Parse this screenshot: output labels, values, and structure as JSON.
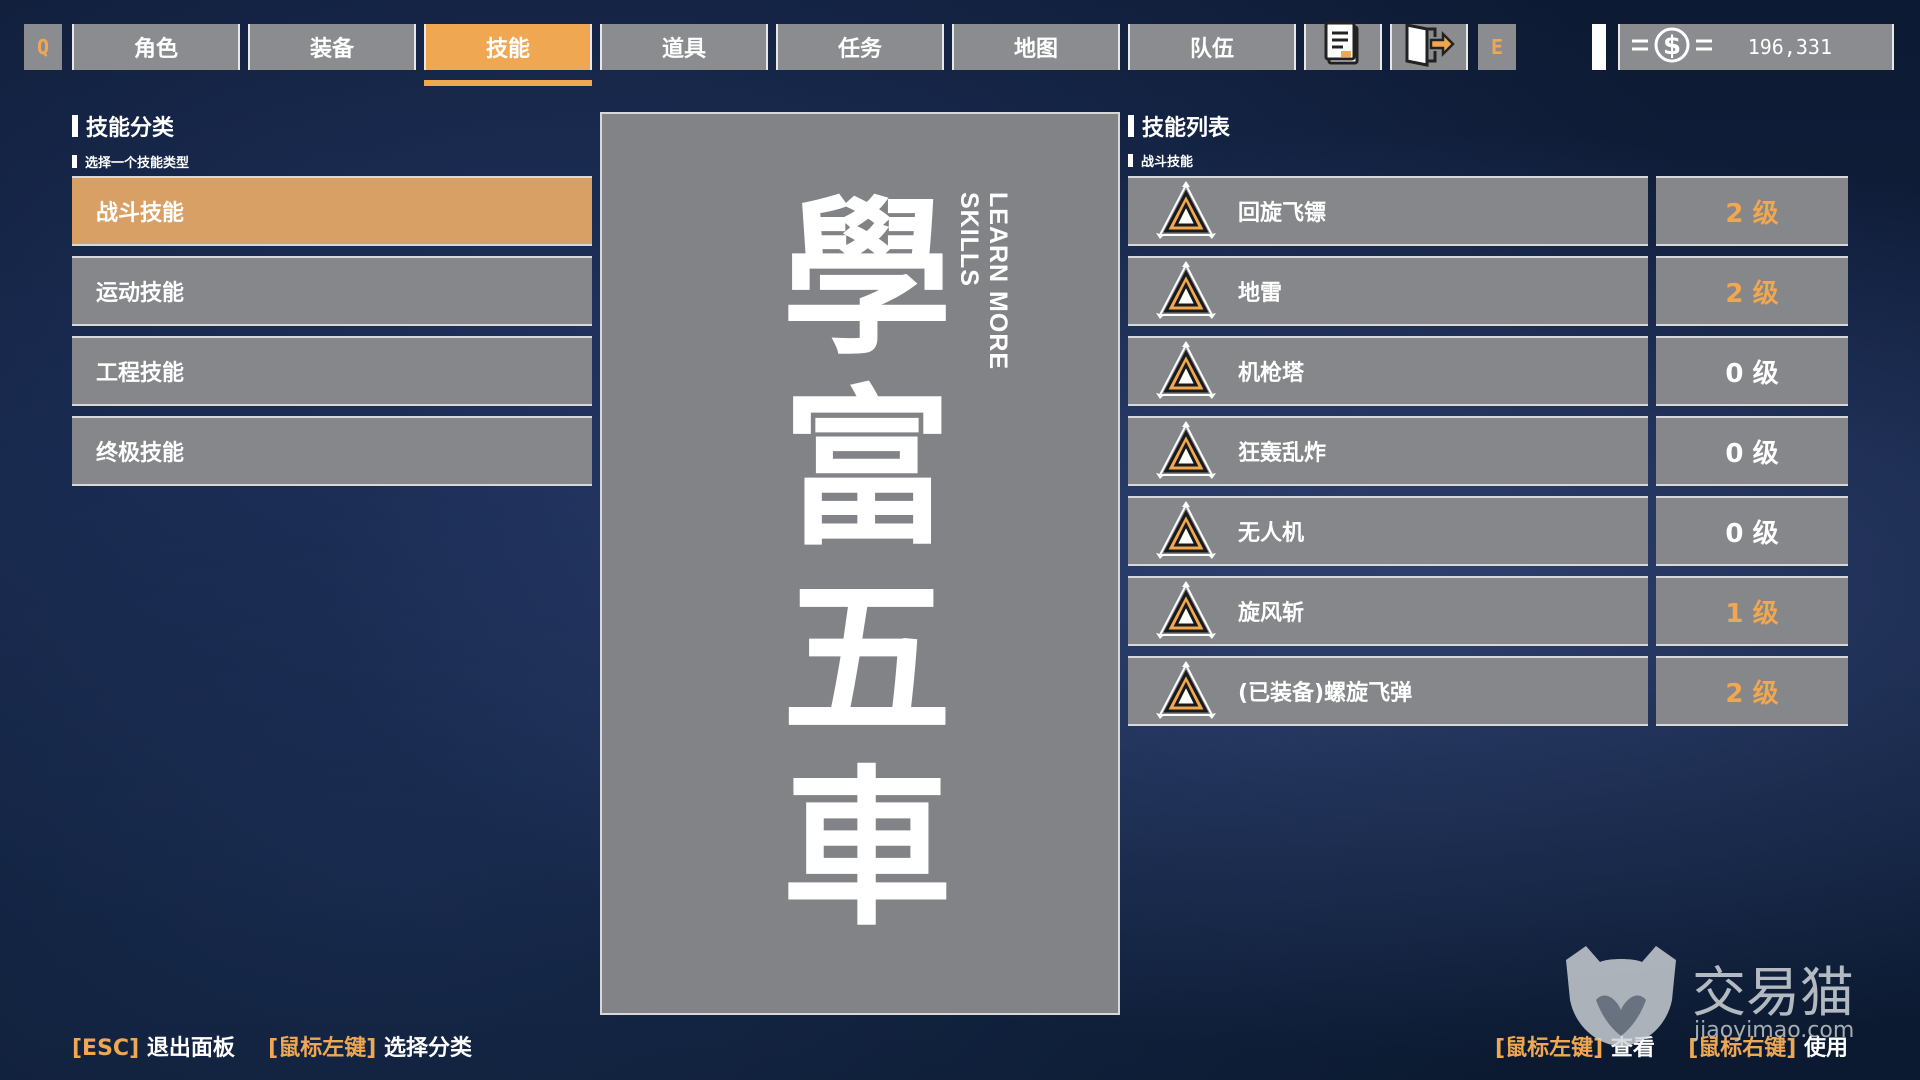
{
  "nav": {
    "left_key": "Q",
    "right_key": "E",
    "tabs": [
      {
        "label": "角色"
      },
      {
        "label": "装备"
      },
      {
        "label": "技能"
      },
      {
        "label": "道具"
      },
      {
        "label": "任务"
      },
      {
        "label": "地图"
      },
      {
        "label": "队伍"
      }
    ],
    "active_tab": "技能",
    "icons": [
      "notes-icon",
      "exit-door-icon"
    ],
    "money": "196,331"
  },
  "categories": {
    "title": "技能分类",
    "subtitle": "选择一个技能类型",
    "items": [
      {
        "label": "战斗技能"
      },
      {
        "label": "运动技能"
      },
      {
        "label": "工程技能"
      },
      {
        "label": "终极技能"
      }
    ],
    "active": "战斗技能"
  },
  "poster": {
    "chars": [
      "學",
      "富",
      "五",
      "車"
    ],
    "vertical_text": "LEARN MORE SKILLS"
  },
  "skills": {
    "title": "技能列表",
    "subtitle": "战斗技能",
    "items": [
      {
        "name": "回旋飞镖",
        "level": "2 级",
        "color": "#f0a752"
      },
      {
        "name": "地雷",
        "level": "2 级",
        "color": "#f0a752"
      },
      {
        "name": "机枪塔",
        "level": "0 级",
        "color": "#ffffff"
      },
      {
        "name": "狂轰乱炸",
        "level": "0 级",
        "color": "#ffffff"
      },
      {
        "name": "无人机",
        "level": "0 级",
        "color": "#ffffff"
      },
      {
        "name": "旋风斩",
        "level": "1 级",
        "color": "#f0a752"
      },
      {
        "name": "(已装备)螺旋飞弹",
        "level": "2 级",
        "color": "#f0a752"
      }
    ]
  },
  "footer": {
    "left": [
      {
        "key": "[ESC]",
        "action": "退出面板"
      },
      {
        "key": "[鼠标左键]",
        "action": "选择分类"
      }
    ],
    "right": [
      {
        "key": "[鼠标左键]",
        "action": "查看"
      },
      {
        "key": "[鼠标右键]",
        "action": "使用"
      }
    ]
  },
  "watermark": {
    "text": "交易猫",
    "url": "jiaoyimao.com"
  }
}
